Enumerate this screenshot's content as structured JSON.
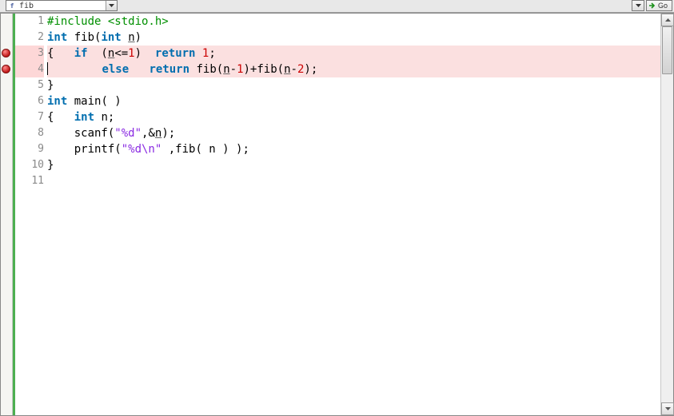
{
  "toolbar": {
    "symbol_field": "fib",
    "go_label": "Go"
  },
  "breakpoints": [
    3,
    4
  ],
  "highlighted_lines": [
    3,
    4
  ],
  "cursor_line": 4,
  "code": {
    "lines": [
      {
        "n": 1,
        "tokens": [
          {
            "t": "#include <stdio.h>",
            "c": "pp"
          }
        ]
      },
      {
        "n": 2,
        "tokens": [
          {
            "t": "int",
            "c": "kw"
          },
          {
            "t": " fib("
          },
          {
            "t": "int",
            "c": "kw"
          },
          {
            "t": " "
          },
          {
            "t": "n",
            "c": "underline"
          },
          {
            "t": ")"
          }
        ]
      },
      {
        "n": 3,
        "tokens": [
          {
            "t": "{   "
          },
          {
            "t": "if",
            "c": "kw"
          },
          {
            "t": "  ("
          },
          {
            "t": "n",
            "c": "underline"
          },
          {
            "t": "<="
          },
          {
            "t": "1",
            "c": "num"
          },
          {
            "t": ")  "
          },
          {
            "t": "return",
            "c": "kw"
          },
          {
            "t": " "
          },
          {
            "t": "1",
            "c": "num"
          },
          {
            "t": ";"
          }
        ]
      },
      {
        "n": 4,
        "cursor_at": 0,
        "tokens": [
          {
            "t": "        "
          },
          {
            "t": "else",
            "c": "kw"
          },
          {
            "t": "   "
          },
          {
            "t": "return",
            "c": "kw"
          },
          {
            "t": " fib("
          },
          {
            "t": "n",
            "c": "underline"
          },
          {
            "t": "-"
          },
          {
            "t": "1",
            "c": "num"
          },
          {
            "t": ")+fib("
          },
          {
            "t": "n",
            "c": "underline"
          },
          {
            "t": "-"
          },
          {
            "t": "2",
            "c": "num"
          },
          {
            "t": ");"
          }
        ]
      },
      {
        "n": 5,
        "tokens": [
          {
            "t": "}"
          }
        ]
      },
      {
        "n": 6,
        "tokens": [
          {
            "t": "int",
            "c": "kw"
          },
          {
            "t": " main( )"
          }
        ]
      },
      {
        "n": 7,
        "tokens": [
          {
            "t": "{   "
          },
          {
            "t": "int",
            "c": "kw"
          },
          {
            "t": " n;"
          }
        ]
      },
      {
        "n": 8,
        "tokens": [
          {
            "t": "    scanf("
          },
          {
            "t": "\"%d\"",
            "c": "str"
          },
          {
            "t": ",&"
          },
          {
            "t": "n",
            "c": "underline"
          },
          {
            "t": ");"
          }
        ]
      },
      {
        "n": 9,
        "tokens": [
          {
            "t": "    printf("
          },
          {
            "t": "\"%d\\n\"",
            "c": "str"
          },
          {
            "t": " ,fib( n ) );"
          }
        ]
      },
      {
        "n": 10,
        "tokens": [
          {
            "t": "}"
          }
        ]
      },
      {
        "n": 11,
        "tokens": [
          {
            "t": ""
          }
        ]
      }
    ]
  }
}
